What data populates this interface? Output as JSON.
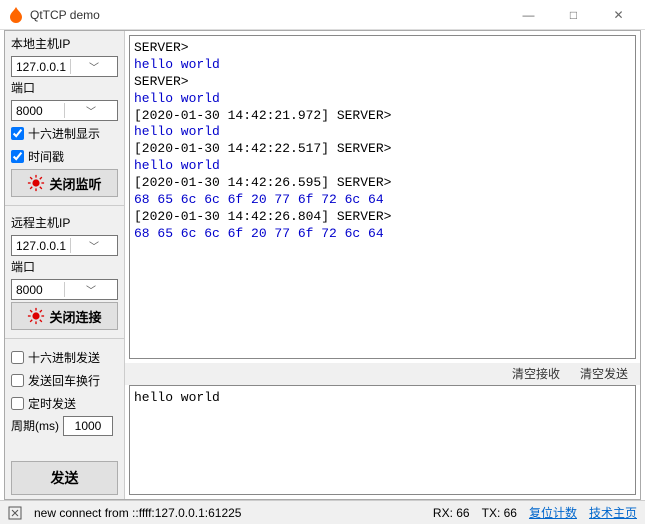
{
  "window": {
    "title": "QtTCP demo",
    "minimize": "—",
    "maximize": "□",
    "close": "✕"
  },
  "sidebar": {
    "local_ip_label": "本地主机IP",
    "local_ip_value": "127.0.0.1",
    "local_port_label": "端口",
    "local_port_value": "8000",
    "hex_display_label": "十六进制显示",
    "timestamp_label": "时间戳",
    "close_listen_btn": "关闭监听",
    "remote_ip_label": "远程主机IP",
    "remote_ip_value": "127.0.0.1",
    "remote_port_label": "端口",
    "remote_port_value": "8000",
    "close_conn_btn": "关闭连接",
    "hex_send_label": "十六进制发送",
    "send_newline_label": "发送回车换行",
    "timed_send_label": "定时发送",
    "period_label": "周期(ms)",
    "period_value": "1000",
    "send_btn": "发送"
  },
  "recv_lines": [
    {
      "cls": "s",
      "text": "SERVER>"
    },
    {
      "cls": "h",
      "text": "hello world"
    },
    {
      "cls": "s",
      "text": "SERVER>"
    },
    {
      "cls": "h",
      "text": "hello world"
    },
    {
      "cls": "s",
      "text": "[2020-01-30 14:42:21.972] SERVER>"
    },
    {
      "cls": "h",
      "text": "hello world"
    },
    {
      "cls": "s",
      "text": "[2020-01-30 14:42:22.517] SERVER>"
    },
    {
      "cls": "h",
      "text": "hello world"
    },
    {
      "cls": "s",
      "text": "[2020-01-30 14:42:26.595] SERVER>"
    },
    {
      "cls": "h",
      "text": "68 65 6c 6c 6f 20 77 6f 72 6c 64"
    },
    {
      "cls": "s",
      "text": "[2020-01-30 14:42:26.804] SERVER>"
    },
    {
      "cls": "h",
      "text": "68 65 6c 6c 6f 20 77 6f 72 6c 64"
    }
  ],
  "clear_recv": "清空接收",
  "clear_send": "清空发送",
  "send_text": "hello world",
  "status": {
    "msg": "new connect from ::ffff:127.0.0.1:61225",
    "rx": "RX: 66",
    "tx": "TX: 66",
    "reset": "复位计数",
    "homepage": "技术主页"
  }
}
